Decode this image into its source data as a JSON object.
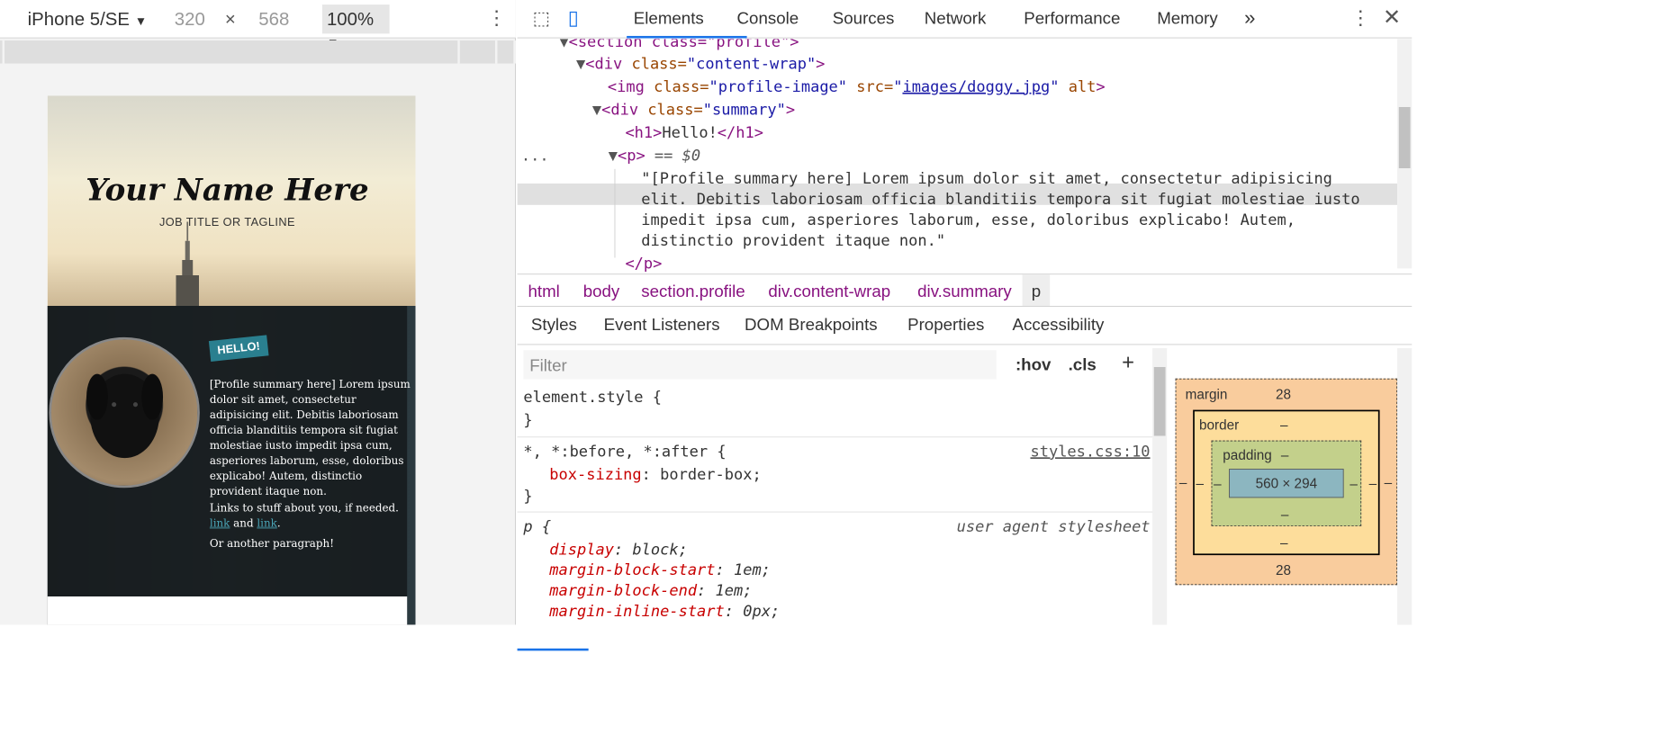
{
  "device_toolbar": {
    "device": "iPhone 5/SE",
    "width": "320",
    "times": "×",
    "height": "568",
    "zoom": "100%"
  },
  "page": {
    "name": "Your Name Here",
    "tagline": "JOB TITLE OR TAGLINE",
    "hello": "HELLO!",
    "summary": "[Profile summary here] Lorem ipsum dolor sit amet, consectetur adipisicing elit. Debitis laboriosam officia blanditiis tempora sit fugiat molestiae iusto impedit ipsa cum, asperiores laborum, esse, doloribus explicabo! Autem, distinctio provident itaque non.",
    "links_pre": "Links to stuff about you, if needed. ",
    "link1": "link",
    "links_mid": " and ",
    "link2": "link",
    "links_post": ".",
    "another": "Or another paragraph!"
  },
  "devtools": {
    "tabs": [
      "Elements",
      "Console",
      "Sources",
      "Network",
      "Performance",
      "Memory"
    ],
    "more": "»",
    "code": {
      "l0_a": "<section class=\"profile\">",
      "l1_tag": "<div",
      "l1_attr": " class=",
      "l1_val": "\"content-wrap\"",
      "l1_end": ">",
      "l2_tag": "<img",
      "l2_attr": " class=",
      "l2_val": "\"profile-image\"",
      "l2_attr2": " src=",
      "l2_q1": "\"",
      "l2_link": "images/doggy.jpg",
      "l2_q2": "\"",
      "l2_attr3": " alt",
      "l2_end": ">",
      "l3_tag": "<div",
      "l3_attr": " class=",
      "l3_val": "\"summary\"",
      "l3_end": ">",
      "l4": "<h1>Hello!</h1>",
      "l4_text": "Hello!",
      "l5_tag": "<p>",
      "l5_eq": " == $0",
      "t1": "\"[Profile summary here] Lorem ipsum dolor sit amet, consectetur adipisicing",
      "t2": "elit. Debitis laboriosam officia blanditiis tempora sit fugiat molestiae iusto",
      "t3": "impedit ipsa cum, asperiores laborum, esse, doloribus explicabo! Autem,",
      "t4": "distinctio provident itaque non.\"",
      "l_close": "</p>",
      "dots": "..."
    },
    "breadcrumbs": [
      "html",
      "body",
      "section.profile",
      "div.content-wrap",
      "div.summary",
      "p"
    ],
    "style_tabs": [
      "Styles",
      "Event Listeners",
      "DOM Breakpoints",
      "Properties",
      "Accessibility"
    ],
    "filter_placeholder": "Filter",
    "hov": ":hov",
    "cls": ".cls",
    "plus": "+",
    "rules": {
      "r1_sel": "element.style {",
      "r1_close": "}",
      "r2_sel": "*, *:before, *:after {",
      "r2_src": "styles.css:10",
      "r2_prop": "box-sizing",
      "r2_val": ": border-box;",
      "r2_close": "}",
      "r3_sel": "p {",
      "r3_src": "user agent stylesheet",
      "r3_p1": "display",
      "r3_v1": ": block;",
      "r3_p2": "margin-block-start",
      "r3_v2": ": 1em;",
      "r3_p3": "margin-block-end",
      "r3_v3": ": 1em;",
      "r3_p4": "margin-inline-start",
      "r3_v4": ": 0px;"
    },
    "box_model": {
      "margin_label": "margin",
      "margin_top": "28",
      "margin_bottom": "28",
      "margin_side": "–",
      "border_label": "border",
      "border_val": "–",
      "padding_label": "padding",
      "padding_val": "–",
      "content": "560 × 294"
    },
    "colors": {
      "selected_tab": "#1a73e8",
      "tag": "#881280",
      "attr": "#994500",
      "value": "#1a1aa6",
      "prop": "#c80000",
      "margin_bg": "#f9cc9d",
      "border_bg": "#fddd9b",
      "padding_bg": "#c3d08b",
      "content_bg": "#8cb6c0"
    }
  }
}
